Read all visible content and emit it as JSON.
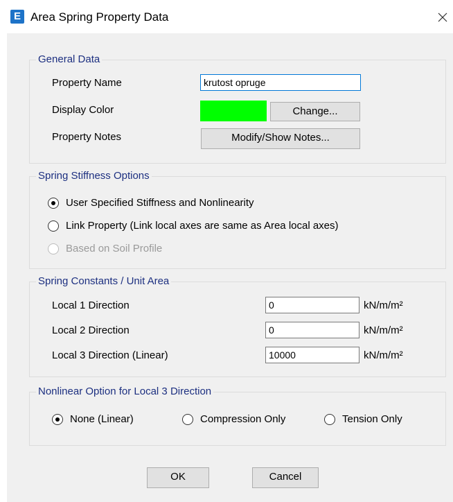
{
  "window": {
    "title": "Area Spring Property Data",
    "app_icon_letter": "E",
    "close_glyph": "✕"
  },
  "general_data": {
    "legend": "General Data",
    "property_name_label": "Property Name",
    "property_name_value": "krutost opruge",
    "display_color_label": "Display Color",
    "display_color": "#00ff00",
    "change_button": "Change...",
    "property_notes_label": "Property Notes",
    "notes_button": "Modify/Show Notes..."
  },
  "spring_stiffness": {
    "legend": "Spring Stiffness Options",
    "options": [
      {
        "label": "User Specified Stiffness and Nonlinearity",
        "selected": true,
        "enabled": true
      },
      {
        "label": "Link Property (Link local axes are same as Area local axes)",
        "selected": false,
        "enabled": true
      },
      {
        "label": "Based on Soil Profile",
        "selected": false,
        "enabled": false
      }
    ]
  },
  "spring_constants": {
    "legend": "Spring Constants / Unit Area",
    "rows": [
      {
        "label": "Local 1 Direction",
        "value": "0",
        "unit": "kN/m/m²"
      },
      {
        "label": "Local 2 Direction",
        "value": "0",
        "unit": "kN/m/m²"
      },
      {
        "label": "Local 3 Direction  (Linear)",
        "value": "10000",
        "unit": "kN/m/m²"
      }
    ]
  },
  "nonlinear_option": {
    "legend": "Nonlinear Option for Local 3 Direction",
    "options": [
      {
        "label": "None (Linear)",
        "selected": true
      },
      {
        "label": "Compression Only",
        "selected": false
      },
      {
        "label": "Tension Only",
        "selected": false
      }
    ]
  },
  "footer": {
    "ok_label": "OK",
    "cancel_label": "Cancel"
  },
  "colors": {
    "legend_text": "#1c2f80",
    "background": "#f0f0f0",
    "swatch": "#00ff00"
  }
}
